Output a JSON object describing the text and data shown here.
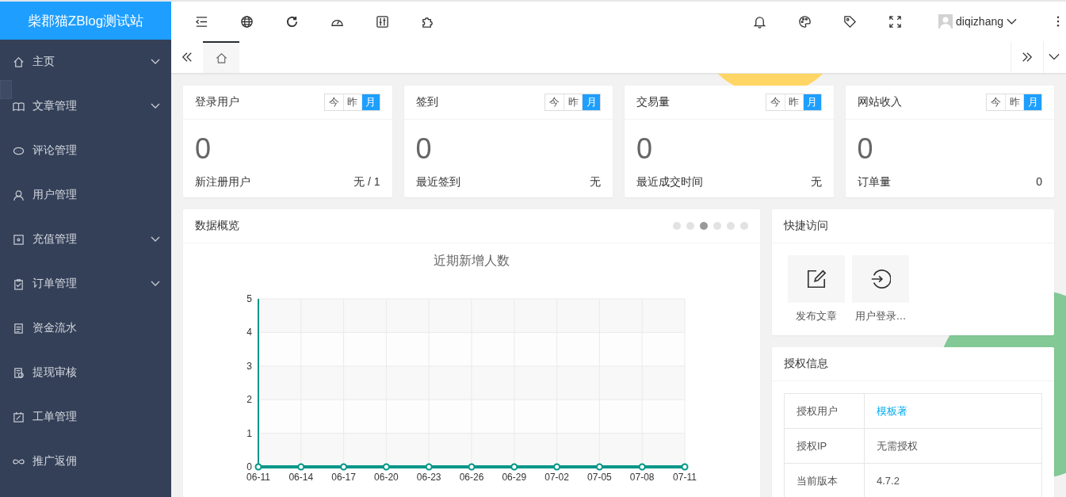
{
  "logo": {
    "title": "柴郡猫ZBlog测试站"
  },
  "user": {
    "name": "diqizhang"
  },
  "sidebar": {
    "items": [
      {
        "label": "主页",
        "expandable": true
      },
      {
        "label": "文章管理",
        "expandable": true
      },
      {
        "label": "评论管理",
        "expandable": false
      },
      {
        "label": "用户管理",
        "expandable": false
      },
      {
        "label": "充值管理",
        "expandable": true
      },
      {
        "label": "订单管理",
        "expandable": true
      },
      {
        "label": "资金流水",
        "expandable": false
      },
      {
        "label": "提现审核",
        "expandable": false
      },
      {
        "label": "工单管理",
        "expandable": false
      },
      {
        "label": "推广返佣",
        "expandable": false
      }
    ]
  },
  "page_tabs": [
    {
      "kind": "home",
      "selected": true
    }
  ],
  "stat_cards": [
    {
      "title": "登录用户",
      "ranges": [
        {
          "label": "今",
          "selected": false
        },
        {
          "label": "昨",
          "selected": false
        },
        {
          "label": "月",
          "selected": true
        }
      ],
      "value": "0",
      "footer_label": "新注册用户",
      "footer_value": "无 / 1"
    },
    {
      "title": "签到",
      "ranges": [
        {
          "label": "今",
          "selected": false
        },
        {
          "label": "昨",
          "selected": false
        },
        {
          "label": "月",
          "selected": true
        }
      ],
      "value": "0",
      "footer_label": "最近签到",
      "footer_value": "无"
    },
    {
      "title": "交易量",
      "ranges": [
        {
          "label": "今",
          "selected": false
        },
        {
          "label": "昨",
          "selected": false
        },
        {
          "label": "月",
          "selected": true
        }
      ],
      "value": "0",
      "footer_label": "最近成交时间",
      "footer_value": "无"
    },
    {
      "title": "网站收入",
      "ranges": [
        {
          "label": "今",
          "selected": false
        },
        {
          "label": "昨",
          "selected": false
        },
        {
          "label": "月",
          "selected": true
        }
      ],
      "value": "0",
      "footer_label": "订单量",
      "footer_value": "0"
    }
  ],
  "overview": {
    "title": "数据概览",
    "pager": [
      {
        "selected": false
      },
      {
        "selected": false
      },
      {
        "selected": true
      },
      {
        "selected": false
      },
      {
        "selected": false
      },
      {
        "selected": false
      }
    ],
    "chart_data": {
      "type": "line",
      "title": "近期新增人数",
      "categories": [
        "06-11",
        "06-14",
        "06-17",
        "06-20",
        "06-23",
        "06-26",
        "06-29",
        "07-02",
        "07-05",
        "07-08",
        "07-11"
      ],
      "series": [
        {
          "color": "#009688",
          "marker": true,
          "values": [
            0,
            0,
            0,
            0,
            0,
            0,
            0,
            0,
            0,
            0,
            0
          ]
        }
      ],
      "grid": true,
      "ylim": [
        0,
        5
      ],
      "yticks": [
        0,
        1,
        2,
        3,
        4,
        5
      ]
    }
  },
  "quick_access": {
    "title": "快捷访问",
    "items": [
      {
        "kind": "edit",
        "label": "发布文章"
      },
      {
        "kind": "login",
        "label": "用户登录…"
      }
    ]
  },
  "license": {
    "title": "授权信息",
    "rows": [
      {
        "label": "授权用户",
        "value": "模板著",
        "link": true
      },
      {
        "label": "授权IP",
        "value": "无需授权",
        "link": false
      },
      {
        "label": "当前版本",
        "value": "4.7.2",
        "link": false
      }
    ]
  }
}
